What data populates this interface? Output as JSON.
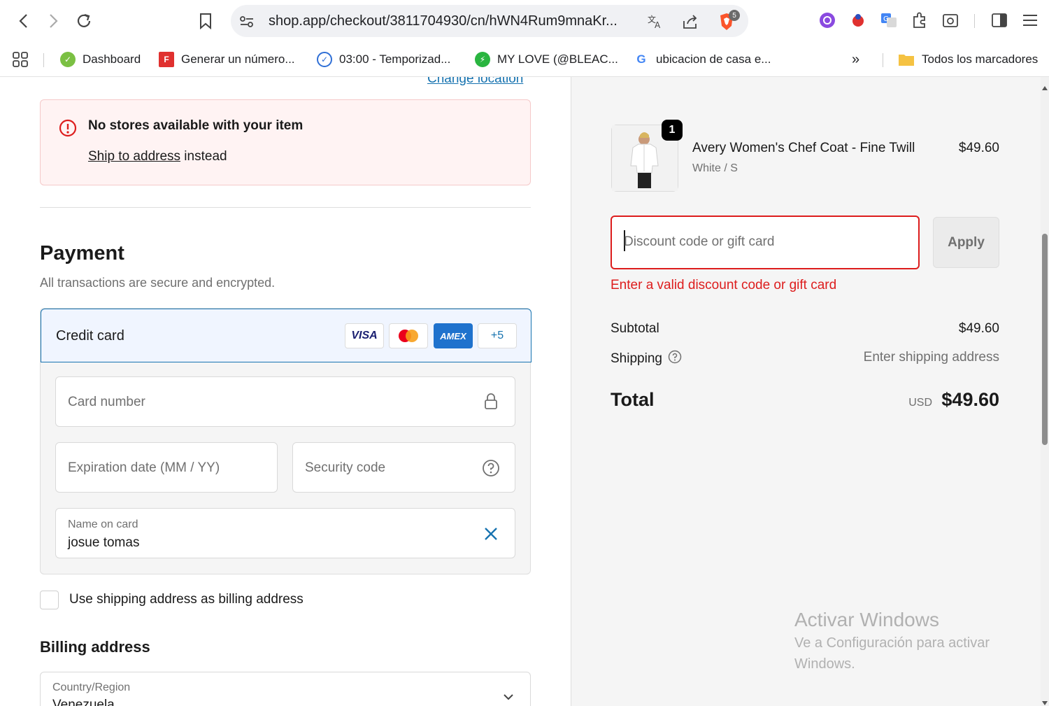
{
  "browser": {
    "url": "shop.app/checkout/3811704930/cn/hWN4Rum9mnaKr...",
    "brave_badge": "5",
    "bookmarks": [
      {
        "label": "Dashboard"
      },
      {
        "label": "Generar un número..."
      },
      {
        "label": "03:00 - Temporizad..."
      },
      {
        "label": "MY LOVE (@BLEAC..."
      },
      {
        "label": "ubicacion de casa e..."
      }
    ],
    "more_bookmarks": "»",
    "all_bookmarks": "Todos los marcadores"
  },
  "delivery": {
    "change_location": "Change location",
    "alert_title": "No stores available with your item",
    "alert_link": "Ship to address",
    "alert_suffix": " instead"
  },
  "payment": {
    "title": "Payment",
    "subtitle": "All transactions are secure and encrypted.",
    "method_label": "Credit card",
    "card_brands": [
      "VISA",
      "Mastercard",
      "AMEX"
    ],
    "more_brands": "+5",
    "card_number_placeholder": "Card number",
    "expiration_placeholder": "Expiration date (MM / YY)",
    "security_placeholder": "Security code",
    "name_label": "Name on card",
    "name_value": "josue tomas",
    "billing_checkbox_label": "Use shipping address as billing address",
    "billing_title": "Billing address",
    "country_label": "Country/Region",
    "country_value": "Venezuela"
  },
  "summary": {
    "item_quantity": "1",
    "item_name": "Avery Women's Chef Coat - Fine Twill",
    "item_variant": "White / S",
    "item_price": "$49.60",
    "discount_placeholder": "Discount code or gift card",
    "apply_label": "Apply",
    "discount_error": "Enter a valid discount code or gift card",
    "subtotal_label": "Subtotal",
    "subtotal_value": "$49.60",
    "shipping_label": "Shipping",
    "shipping_value": "Enter shipping address",
    "total_label": "Total",
    "total_currency": "USD",
    "total_value": "$49.60"
  },
  "watermark": {
    "title": "Activar Windows",
    "subtitle": "Ve a Configuración para activar Windows."
  },
  "colors": {
    "accent": "#1773b0",
    "error": "#dd1d1d",
    "alert_bg": "#fff3f3"
  }
}
